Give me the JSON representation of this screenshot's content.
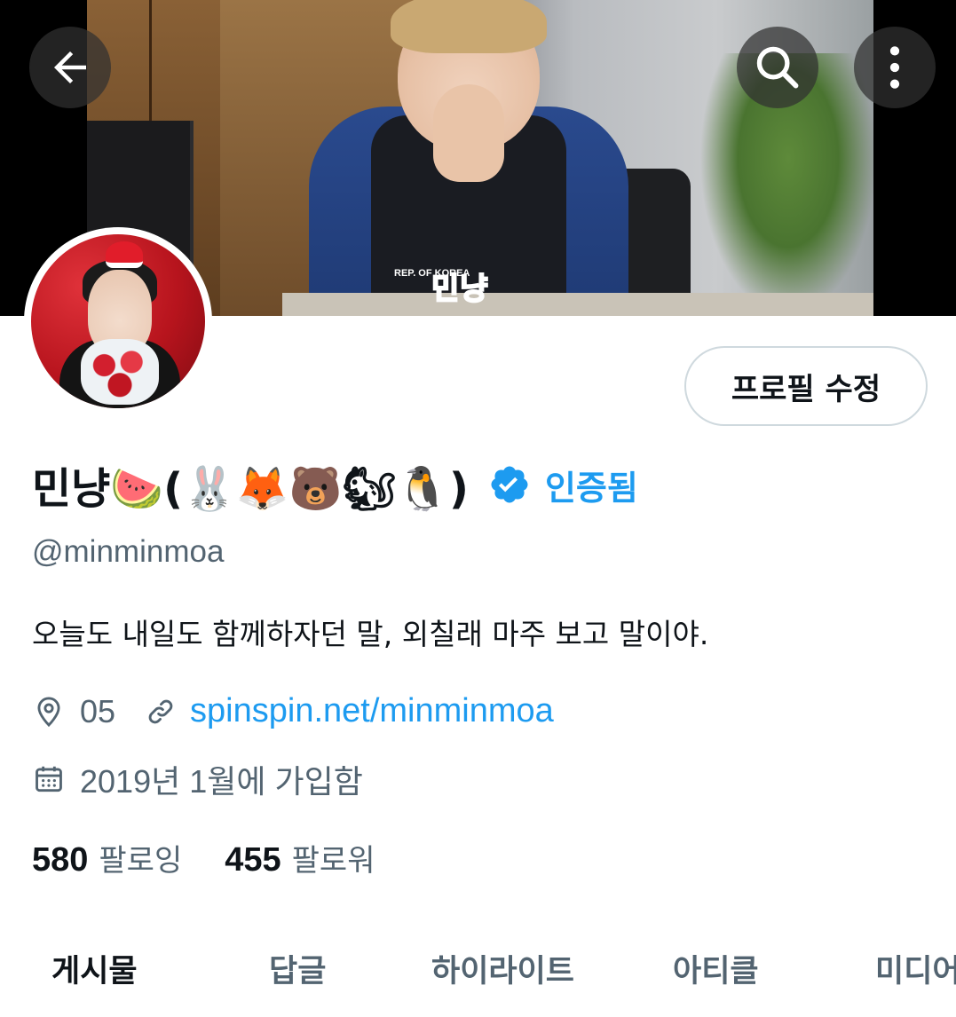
{
  "header": {
    "banner_caption": "민냥",
    "banner_vest_text": "REP. OF KOREA",
    "back_icon": "arrow-left-icon",
    "search_icon": "search-icon",
    "more_icon": "more-vertical-icon"
  },
  "profile": {
    "display_name": "민냥🍉(🐰🦊🐻🐿🐧)",
    "verified_label": "인증됨",
    "handle": "@minminmoa",
    "bio": "오늘도 내일도 함께하자던 말,  외칠래 마주 보고 말이야.",
    "location": "05",
    "website": "spinspin.net/minminmoa",
    "joined": "2019년 1월에 가입함",
    "edit_button": "프로필 수정"
  },
  "stats": {
    "following_count": "580",
    "following_label": "팔로잉",
    "followers_count": "455",
    "followers_label": "팔로워"
  },
  "tabs": [
    {
      "label": "게시물",
      "active": true
    },
    {
      "label": "답글",
      "active": false
    },
    {
      "label": "하이라이트",
      "active": false
    },
    {
      "label": "아티클",
      "active": false
    },
    {
      "label": "미디어",
      "active": false
    }
  ],
  "colors": {
    "accent": "#1d9bf0",
    "text_primary": "#0f1419",
    "text_secondary": "#536471",
    "border": "#cfd9de"
  }
}
